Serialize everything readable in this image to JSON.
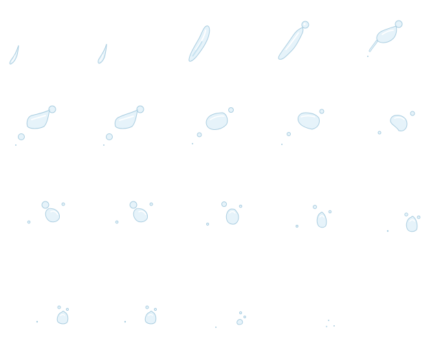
{
  "sprite_sheet": {
    "description_label": "",
    "columns": 5,
    "rows": 4,
    "frame_count": 19,
    "colors": {
      "fill": "#e6f3fa",
      "shade": "#c7e2f0",
      "outline": "#a9cde0",
      "highlight": "#ffffff"
    }
  }
}
